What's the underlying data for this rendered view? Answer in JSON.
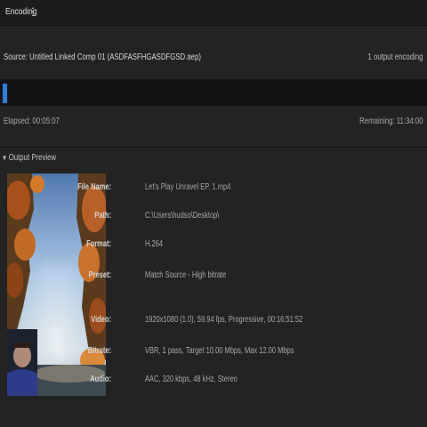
{
  "tab": {
    "title": "Encoding",
    "menu_icon": "⋮"
  },
  "source": {
    "label": "Source: Untitled Linked Comp 01 (ASDFASFHGASDFGSD.aep)",
    "output_count": "1 output encoding"
  },
  "progress": {
    "fraction": 0.01,
    "color": "#2f7fd6"
  },
  "time": {
    "elapsed": "Elapsed: 00:05:07",
    "remaining": "Remaining: 11:34:00"
  },
  "preview": {
    "header": "Output Preview",
    "fields": [
      {
        "label": "File Name:",
        "value": "Let's Play Unravel EP. 1.mp4"
      },
      {
        "label": "Path:",
        "value": "C:\\Users\\hudso\\Desktop\\"
      },
      {
        "label": "Format:",
        "value": "H.264"
      },
      {
        "label": "Preset:",
        "value": "Match Source - High bitrate"
      },
      {
        "label": "Video:",
        "value": "1920x1080 (1.0), 59.94 fps, Progressive, 00:16:51:52"
      },
      {
        "label": "Bitrate:",
        "value": "VBR, 1 pass, Target 10.00 Mbps, Max 12.00 Mbps"
      },
      {
        "label": "Audio:",
        "value": "AAC, 320 kbps, 48 kHz, Stereo"
      }
    ]
  },
  "colors": {
    "background": "#232323",
    "accent": "#2f7fd6"
  }
}
